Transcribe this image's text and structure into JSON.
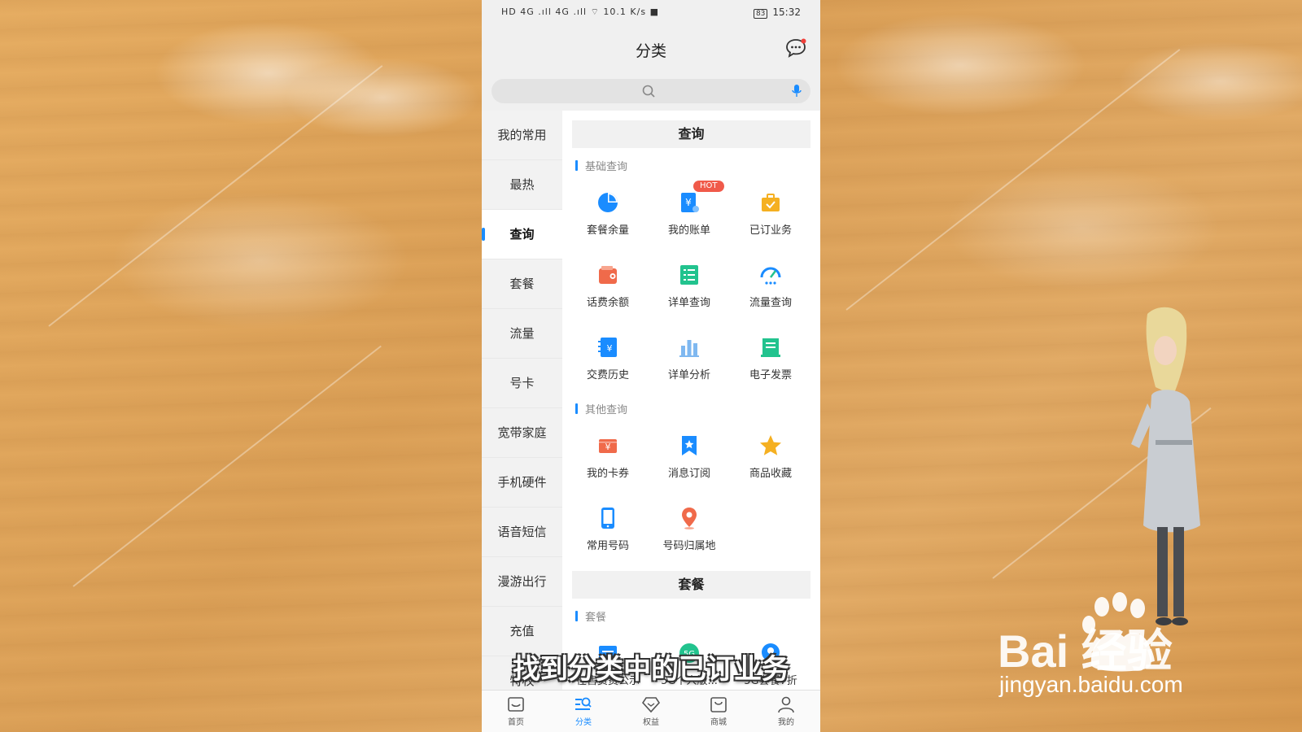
{
  "status_bar": {
    "left": "HD 4G .ıll 4G .ıll ⌔ 10.1 K/s ■",
    "battery": "83",
    "time": "15:32"
  },
  "header": {
    "title": "分类",
    "message_icon": "chat-bubble-icon"
  },
  "search": {
    "placeholder": ""
  },
  "sidebar": {
    "items": [
      {
        "label": "我的常用"
      },
      {
        "label": "最热"
      },
      {
        "label": "查询"
      },
      {
        "label": "套餐"
      },
      {
        "label": "流量"
      },
      {
        "label": "号卡"
      },
      {
        "label": "宽带家庭"
      },
      {
        "label": "手机硬件"
      },
      {
        "label": "语音短信"
      },
      {
        "label": "漫游出行"
      },
      {
        "label": "充值"
      },
      {
        "label": "特权"
      }
    ],
    "active_index": 2
  },
  "content": {
    "section1": {
      "title": "查询",
      "group1": {
        "title": "基础查询",
        "items": [
          {
            "label": "套餐余量",
            "icon": "pie-chart-icon",
            "color": "#1a8cff"
          },
          {
            "label": "我的账单",
            "icon": "bill-icon",
            "color": "#1a8cff",
            "badge": "HOT"
          },
          {
            "label": "已订业务",
            "icon": "briefcase-check-icon",
            "color": "#f5b021"
          },
          {
            "label": "话费余额",
            "icon": "wallet-icon",
            "color": "#f06a4a"
          },
          {
            "label": "详单查询",
            "icon": "list-icon",
            "color": "#22c38e"
          },
          {
            "label": "流量查询",
            "icon": "gauge-icon",
            "color": "#1a8cff"
          },
          {
            "label": "交费历史",
            "icon": "payment-history-icon",
            "color": "#1a8cff"
          },
          {
            "label": "详单分析",
            "icon": "bar-chart-icon",
            "color": "#7fb8f0"
          },
          {
            "label": "电子发票",
            "icon": "invoice-icon",
            "color": "#22c38e"
          }
        ]
      },
      "group2": {
        "title": "其他查询",
        "items": [
          {
            "label": "我的卡券",
            "icon": "coupon-icon",
            "color": "#f06a4a"
          },
          {
            "label": "消息订阅",
            "icon": "bookmark-star-icon",
            "color": "#1a8cff"
          },
          {
            "label": "商品收藏",
            "icon": "star-icon",
            "color": "#f5b021"
          },
          {
            "label": "常用号码",
            "icon": "phone-device-icon",
            "color": "#1a8cff"
          },
          {
            "label": "号码归属地",
            "icon": "location-pin-icon",
            "color": "#f06a4a"
          }
        ]
      }
    },
    "section2": {
      "title": "套餐",
      "group1": {
        "title": "套餐",
        "items": [
          {
            "label": "在售资费公示",
            "icon": "tariff-icon",
            "color": "#1a8cff"
          },
          {
            "label": "5G个人版...",
            "icon": "5g-icon",
            "color": "#22c38e"
          },
          {
            "label": "5G套餐7折",
            "icon": "discount-icon",
            "color": "#1a8cff"
          }
        ]
      }
    }
  },
  "tabbar": {
    "items": [
      {
        "label": "首页",
        "icon": "home-icon"
      },
      {
        "label": "分类",
        "icon": "category-icon"
      },
      {
        "label": "权益",
        "icon": "diamond-icon"
      },
      {
        "label": "商城",
        "icon": "shopping-bag-icon"
      },
      {
        "label": "我的",
        "icon": "user-icon"
      }
    ],
    "active_index": 1
  },
  "overlay": {
    "subtitle": "找到分类中的已订业务",
    "watermark_brand": "Bai 经验",
    "watermark_url": "jingyan.baidu.com"
  },
  "colors": {
    "accent": "#1a8cff",
    "hot_badge": "#f05a4a"
  }
}
